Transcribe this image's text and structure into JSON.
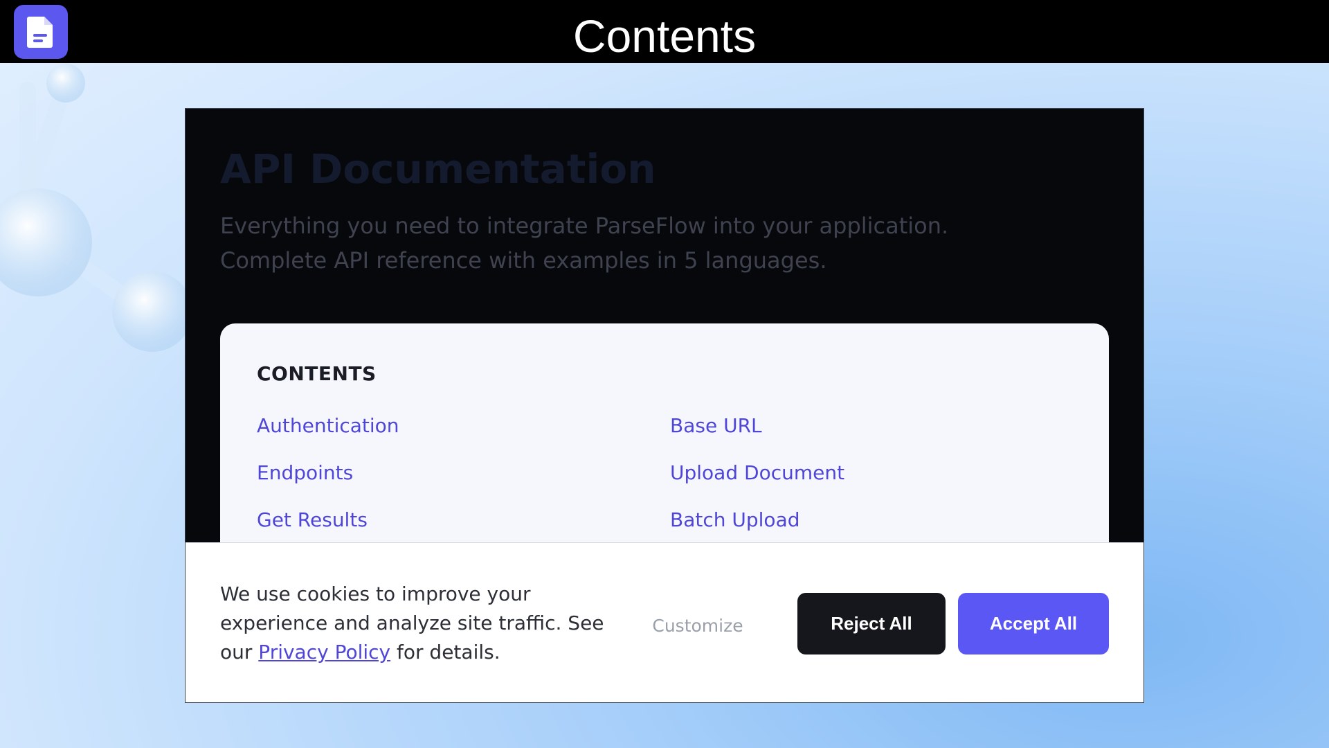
{
  "top_bar": {
    "title": "Contents",
    "app_icon": "document-icon"
  },
  "doc": {
    "title": "API Documentation",
    "description": "Everything you need to integrate ParseFlow into your application. Complete API reference with examples in 5 languages."
  },
  "toc": {
    "heading": "CONTENTS",
    "links": [
      "Authentication",
      "Base URL",
      "Endpoints",
      "Upload Document",
      "Get Results",
      "Batch Upload"
    ]
  },
  "cookie": {
    "text_before": "We use cookies to improve your experience and analyze site traffic. See our ",
    "policy_link": "Privacy Policy",
    "text_after": " for details.",
    "customize_label": "Customize",
    "reject_label": "Reject All",
    "accept_label": "Accept All"
  },
  "colors": {
    "accent": "#5b57f5",
    "link": "#4f46d8",
    "frame_bg": "#07080c"
  }
}
